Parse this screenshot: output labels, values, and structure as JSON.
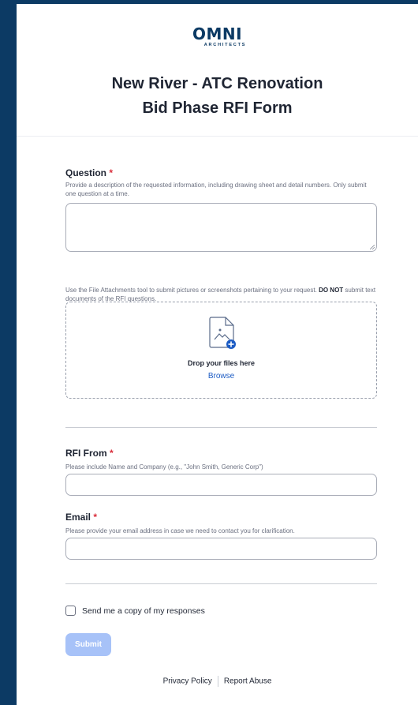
{
  "logo": {
    "main": "OMNI",
    "sub": "ARCHITECTS"
  },
  "form": {
    "title_line1": "New River - ATC Renovation",
    "title_line2": "Bid Phase RFI Form"
  },
  "question": {
    "label": "Question",
    "required_mark": "*",
    "help": "Provide a description of the requested information, including drawing sheet and detail numbers. Only submit one question at a time.",
    "value": ""
  },
  "attachments": {
    "help_prefix": "Use the File Attachments tool to submit pictures or screenshots pertaining to your request.",
    "help_bold": "DO NOT",
    "help_suffix": "submit text documents of the RFI questions.",
    "drop_text": "Drop your files here",
    "browse_label": "Browse"
  },
  "rfi_from": {
    "label": "RFI From",
    "required_mark": "*",
    "help": "Please include Name and Company (e.g., \"John Smith, Generic Corp\")",
    "value": ""
  },
  "email": {
    "label": "Email",
    "required_mark": "*",
    "help": "Please provide your email address in case we need to contact you for clarification.",
    "value": ""
  },
  "copy_checkbox": {
    "label": "Send me a copy of my responses",
    "checked": false
  },
  "submit_label": "Submit",
  "footer": {
    "privacy": "Privacy Policy",
    "abuse": "Report Abuse"
  },
  "colors": {
    "background": "#0c3a64",
    "required": "#d92d3a",
    "link": "#1d5cc4",
    "submit_disabled": "#a7c2f8"
  }
}
